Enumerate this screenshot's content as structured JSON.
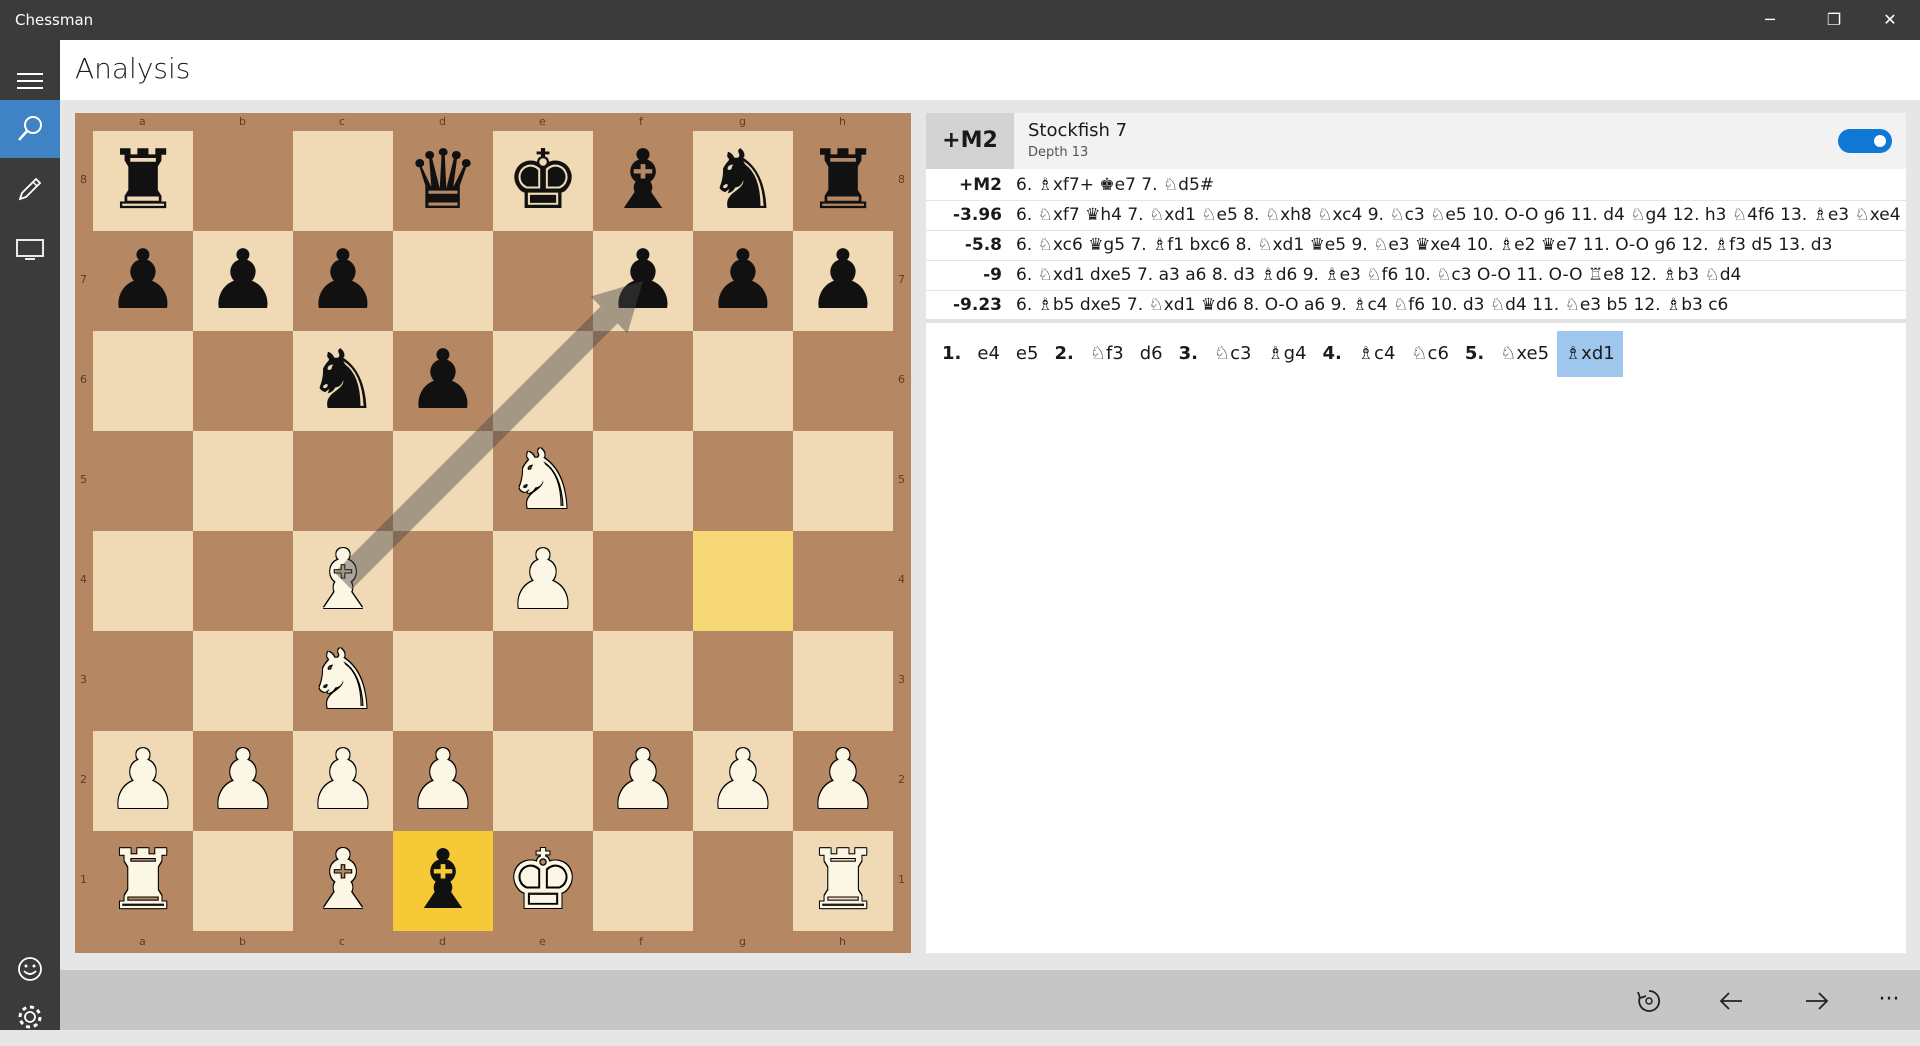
{
  "app": {
    "title": "Chessman",
    "accent": "#3f83c4"
  },
  "window_controls": {
    "minimize": "─",
    "maximize": "❐",
    "close": "✕"
  },
  "header": {
    "title": "Analysis"
  },
  "sidebar": {
    "items": [
      {
        "name": "menu",
        "icon": "hamburger-icon"
      },
      {
        "name": "analysis",
        "icon": "search-icon",
        "active": true
      },
      {
        "name": "edit",
        "icon": "pencil-icon"
      },
      {
        "name": "display",
        "icon": "monitor-icon"
      },
      {
        "name": "feedback",
        "icon": "smiley-icon"
      },
      {
        "name": "settings",
        "icon": "gear-icon"
      }
    ]
  },
  "board": {
    "files": [
      "a",
      "b",
      "c",
      "d",
      "e",
      "f",
      "g",
      "h"
    ],
    "ranks": [
      "8",
      "7",
      "6",
      "5",
      "4",
      "3",
      "2",
      "1"
    ],
    "rows": [
      [
        "br",
        "",
        "",
        "bq",
        "bk",
        "bb",
        "bn",
        "br"
      ],
      [
        "bp",
        "bp",
        "bp",
        "",
        "",
        "bp",
        "bp",
        "bp"
      ],
      [
        "",
        "",
        "bn",
        "bp",
        "",
        "",
        "",
        ""
      ],
      [
        "",
        "",
        "",
        "",
        "wn",
        "",
        "",
        ""
      ],
      [
        "",
        "",
        "wb",
        "",
        "wp",
        "",
        "",
        ""
      ],
      [
        "",
        "",
        "wn",
        "",
        "",
        "",
        "",
        ""
      ],
      [
        "wp",
        "wp",
        "wp",
        "wp",
        "",
        "wp",
        "wp",
        "wp"
      ],
      [
        "wr",
        "",
        "wb",
        "bb",
        "wk",
        "",
        "",
        "wr"
      ]
    ],
    "last_move": {
      "from": "g4",
      "to": "d1"
    },
    "arrow": {
      "from": "c4",
      "to": "f7"
    },
    "colors": {
      "light": "#f0d9b5",
      "dark": "#b58863"
    }
  },
  "engine": {
    "eval": "+M2",
    "name": "Stockfish 7",
    "depth": "Depth 13",
    "enabled": true,
    "lines": [
      {
        "eval": "+M2",
        "pv": "6. ♗xf7+ ♚e7 7. ♘d5#"
      },
      {
        "eval": "-3.96",
        "pv": "6. ♘xf7 ♛h4 7. ♘xd1 ♘e5 8. ♘xh8 ♘xc4 9. ♘c3 ♘e5 10. O-O g6 11. d4 ♘g4 12. h3 ♘4f6 13. ♗e3 ♘xe4"
      },
      {
        "eval": "-5.8",
        "pv": "6. ♘xc6 ♛g5 7. ♗f1 bxc6 8. ♘xd1 ♛e5 9. ♘e3 ♛xe4 10. ♗e2 ♛e7 11. O-O g6 12. ♗f3 d5 13. d3"
      },
      {
        "eval": "-9",
        "pv": "6. ♘xd1 dxe5 7. a3 a6 8. d3 ♗d6 9. ♗e3 ♘f6 10. ♘c3 O-O 11. O-O ♖e8 12. ♗b3 ♘d4"
      },
      {
        "eval": "-9.23",
        "pv": "6. ♗b5 dxe5 7. ♘xd1 ♛d6 8. O-O a6 9. ♗c4 ♘f6 10. d3 ♘d4 11. ♘e3 b5 12. ♗b3 c6"
      }
    ]
  },
  "moves": [
    {
      "t": "1.",
      "num": true
    },
    {
      "t": "e4"
    },
    {
      "t": "e5"
    },
    {
      "t": "2.",
      "num": true
    },
    {
      "t": "♘f3"
    },
    {
      "t": "d6"
    },
    {
      "t": "3.",
      "num": true
    },
    {
      "t": "♘c3"
    },
    {
      "t": "♗g4"
    },
    {
      "t": "4.",
      "num": true
    },
    {
      "t": "♗c4"
    },
    {
      "t": "♘c6"
    },
    {
      "t": "5.",
      "num": true
    },
    {
      "t": "♘xe5"
    },
    {
      "t": "♗xd1",
      "selected": true
    }
  ],
  "bottom_bar": {
    "buttons": [
      {
        "name": "flip-board",
        "icon": "rotate-icon"
      },
      {
        "name": "previous-move",
        "icon": "arrow-left-icon"
      },
      {
        "name": "next-move",
        "icon": "arrow-right-icon"
      },
      {
        "name": "more",
        "icon": "more-icon",
        "label": "···"
      }
    ]
  }
}
